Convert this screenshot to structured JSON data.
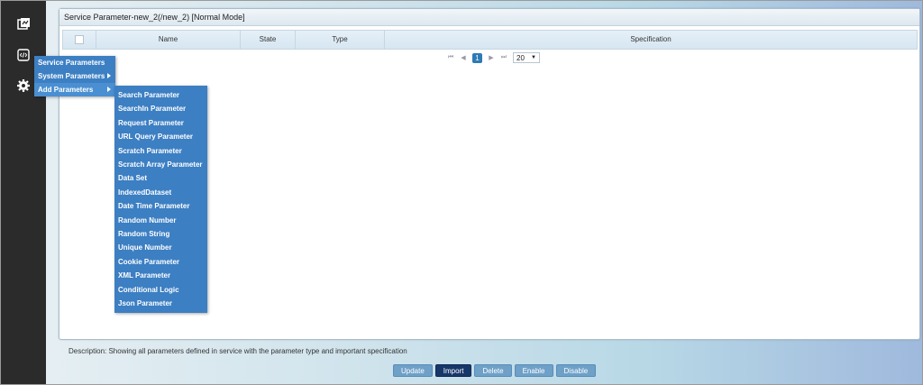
{
  "panel": {
    "title": "Service Parameter-new_2(/new_2) [Normal Mode]"
  },
  "grid": {
    "columns": [
      "Name",
      "State",
      "Type",
      "Specification"
    ]
  },
  "pager": {
    "current_page": "1",
    "page_size": "20"
  },
  "context_menu": {
    "items": [
      {
        "label": "Service Parameters"
      },
      {
        "label": "System Parameters"
      },
      {
        "label": "Add Parameters"
      }
    ]
  },
  "submenu": {
    "items": [
      "Search Parameter",
      "SearchIn Parameter",
      "Request Parameter",
      "URL Query Parameter",
      "Scratch Parameter",
      "Scratch Array Parameter",
      "Data Set",
      "IndexedDataset",
      "Date Time Parameter",
      "Random Number",
      "Random String",
      "Unique Number",
      "Cookie Parameter",
      "XML Parameter",
      "Conditional Logic",
      "Json Parameter"
    ]
  },
  "footer": {
    "description": "Description: Showing all parameters defined in service with the parameter type and important specification",
    "buttons": [
      "Update",
      "Import",
      "Delete",
      "Enable",
      "Disable"
    ]
  }
}
